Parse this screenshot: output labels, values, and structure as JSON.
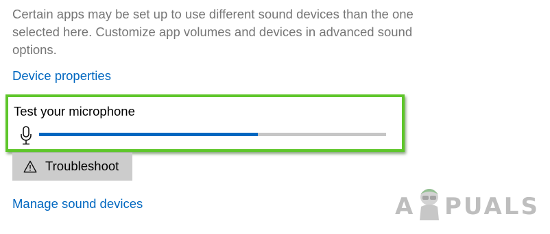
{
  "sound_settings": {
    "description": "Certain apps may be set up to use different sound devices than the one selected here. Customize app volumes and devices in advanced sound options.",
    "device_properties_link": "Device properties",
    "manage_sound_devices_link": "Manage sound devices"
  },
  "microphone_test": {
    "title": "Test your microphone",
    "icon": "microphone-icon",
    "level_fraction": 0.63
  },
  "troubleshoot_button": {
    "label": "Troubleshoot",
    "icon": "warning-icon"
  },
  "watermark": {
    "text": "APPUALS"
  },
  "colors": {
    "link": "#0067c0",
    "meter_fill": "#0067c0",
    "meter_track": "#c6c6c6",
    "highlight_border": "#5ec62a",
    "button_bg": "#cccccc",
    "description_text": "#767676"
  }
}
